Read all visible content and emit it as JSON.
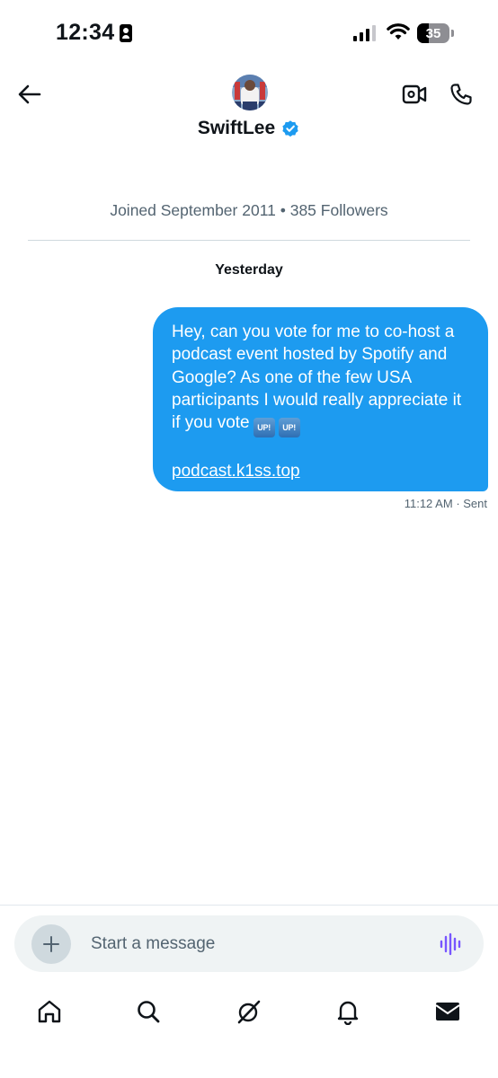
{
  "status_bar": {
    "time": "12:34",
    "battery_level": "35"
  },
  "header": {
    "name": "SwiftLee",
    "icons": {
      "back": "arrow-left-icon",
      "video": "video-camera-icon",
      "call": "phone-icon",
      "verified": "verified-badge-icon"
    }
  },
  "profile_info": "Joined September 2011 • 385 Followers",
  "date_separator": "Yesterday",
  "message": {
    "text": "Hey, can you vote for me to co-host a podcast event hosted by Spotify and Google? As one of the few USA participants I would really appreciate it if you vote",
    "emojis": [
      "UP!",
      "UP!"
    ],
    "link": "podcast.k1ss.top",
    "time": "11:12 AM",
    "status": "· Sent"
  },
  "composer": {
    "placeholder": "Start a message"
  },
  "nav": [
    "home-icon",
    "search-icon",
    "grok-icon",
    "notifications-bell-icon",
    "messages-envelope-icon"
  ],
  "colors": {
    "accent": "#1d9bf0",
    "text": "#0f1419",
    "muted": "#536471",
    "voice_accent": "#7856ff"
  }
}
